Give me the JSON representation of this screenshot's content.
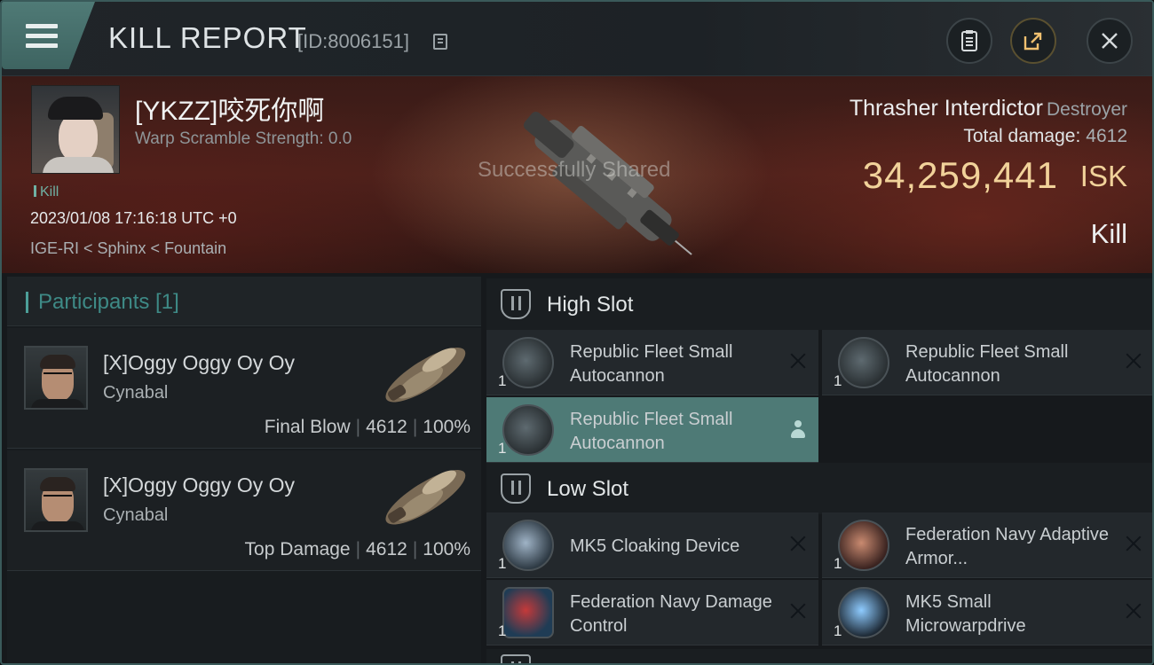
{
  "header": {
    "title": "KILL REPORT",
    "report_id": "[ID:8006151]"
  },
  "victim": {
    "name": "[YKZZ]咬死你啊",
    "warp_scramble": "Warp Scramble Strength: 0.0",
    "tag": "Kill",
    "datetime": "2023/01/08 17:16:18 UTC +0",
    "location": "IGE-RI < Sphinx < Fountain",
    "ship_name": "Thrasher Interdictor",
    "ship_class": "Destroyer",
    "total_damage_label": "Total damage:",
    "total_damage": "4612",
    "isk_value": "34,259,441",
    "isk_unit": "ISK",
    "result": "Kill",
    "share_toast": "Successfully Shared"
  },
  "participants": {
    "title": "Participants [1]",
    "items": [
      {
        "name": "[X]Oggy Oggy Oy Oy",
        "ship": "Cynabal",
        "role": "Final Blow",
        "damage": "4612",
        "percent": "100%"
      },
      {
        "name": "[X]Oggy Oggy Oy Oy",
        "ship": "Cynabal",
        "role": "Top Damage",
        "damage": "4612",
        "percent": "100%"
      }
    ]
  },
  "fitting": {
    "high_slot": {
      "label": "High Slot",
      "modules": [
        {
          "qty": "1",
          "name": "Republic Fleet Small Autocannon",
          "icon": "autocannon-icon"
        },
        {
          "qty": "1",
          "name": "Republic Fleet Small Autocannon",
          "icon": "autocannon-icon"
        },
        {
          "qty": "1",
          "name": "Republic Fleet Small Autocannon",
          "icon": "autocannon-icon",
          "selected": true
        }
      ]
    },
    "low_slot": {
      "label": "Low Slot",
      "modules": [
        {
          "qty": "1",
          "name": "MK5 Cloaking Device",
          "icon": "cloaking-device-icon"
        },
        {
          "qty": "1",
          "name": "Federation Navy Adaptive Armor...",
          "icon": "armor-hardener-icon"
        },
        {
          "qty": "1",
          "name": "Federation Navy Damage Control",
          "icon": "damage-control-icon"
        },
        {
          "qty": "1",
          "name": "MK5 Small Microwarpdrive",
          "icon": "microwarpdrive-icon"
        }
      ]
    }
  },
  "colors": {
    "accent": "#4e7a76",
    "isk": "#f1d29a",
    "participants_title": "#3e8a86"
  }
}
